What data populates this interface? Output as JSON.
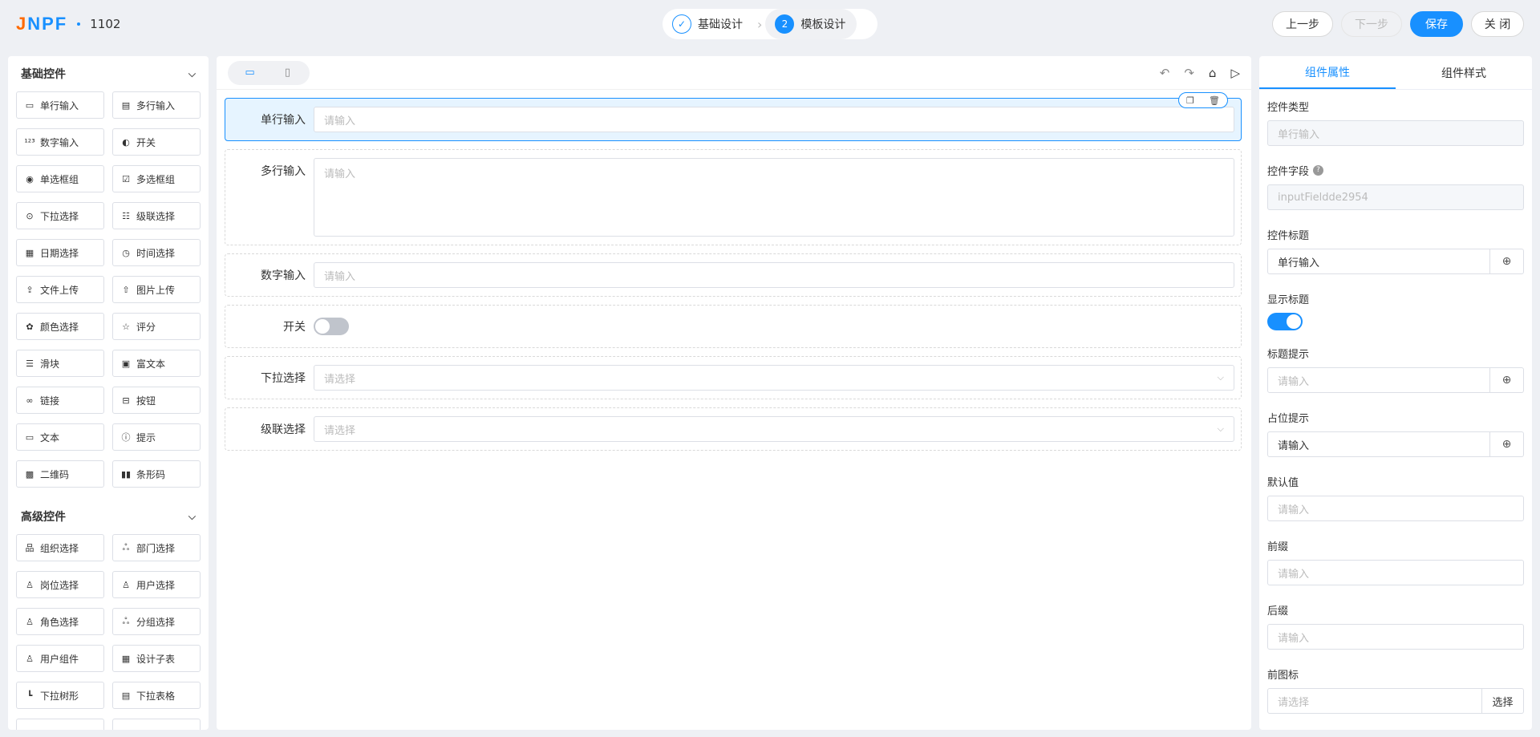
{
  "header": {
    "logo": "JNPF",
    "project_name": "1102",
    "steps": [
      {
        "label": "基础设计",
        "marker": "✓"
      },
      {
        "label": "模板设计",
        "marker": "2"
      }
    ],
    "buttons": {
      "prev": "上一步",
      "next": "下一步",
      "save": "保存",
      "close": "关 闭"
    }
  },
  "left_panel": {
    "basic_title": "基础控件",
    "basic_items": [
      {
        "label": "单行输入",
        "icon": "input-icon"
      },
      {
        "label": "多行输入",
        "icon": "textarea-icon"
      },
      {
        "label": "数字输入",
        "icon": "number-icon"
      },
      {
        "label": "开关",
        "icon": "switch-icon"
      },
      {
        "label": "单选框组",
        "icon": "radio-icon"
      },
      {
        "label": "多选框组",
        "icon": "checkbox-icon"
      },
      {
        "label": "下拉选择",
        "icon": "select-icon"
      },
      {
        "label": "级联选择",
        "icon": "cascader-icon"
      },
      {
        "label": "日期选择",
        "icon": "calendar-icon"
      },
      {
        "label": "时间选择",
        "icon": "clock-icon"
      },
      {
        "label": "文件上传",
        "icon": "upload-icon"
      },
      {
        "label": "图片上传",
        "icon": "image-upload-icon"
      },
      {
        "label": "颜色选择",
        "icon": "palette-icon"
      },
      {
        "label": "评分",
        "icon": "star-icon"
      },
      {
        "label": "滑块",
        "icon": "slider-icon"
      },
      {
        "label": "富文本",
        "icon": "rich-text-icon"
      },
      {
        "label": "链接",
        "icon": "link-icon"
      },
      {
        "label": "按钮",
        "icon": "button-icon"
      },
      {
        "label": "文本",
        "icon": "text-icon"
      },
      {
        "label": "提示",
        "icon": "alert-icon"
      },
      {
        "label": "二维码",
        "icon": "qrcode-icon"
      },
      {
        "label": "条形码",
        "icon": "barcode-icon"
      }
    ],
    "advanced_title": "高级控件",
    "advanced_items": [
      {
        "label": "组织选择",
        "icon": "org-icon"
      },
      {
        "label": "部门选择",
        "icon": "department-icon"
      },
      {
        "label": "岗位选择",
        "icon": "position-icon"
      },
      {
        "label": "用户选择",
        "icon": "user-icon"
      },
      {
        "label": "角色选择",
        "icon": "role-icon"
      },
      {
        "label": "分组选择",
        "icon": "group-icon"
      },
      {
        "label": "用户组件",
        "icon": "user-component-icon"
      },
      {
        "label": "设计子表",
        "icon": "table-icon"
      },
      {
        "label": "下拉树形",
        "icon": "tree-icon"
      },
      {
        "label": "下拉表格",
        "icon": "select-table-icon"
      }
    ]
  },
  "canvas": {
    "fields": [
      {
        "label": "单行输入",
        "placeholder": "请输入"
      },
      {
        "label": "多行输入",
        "placeholder": "请输入"
      },
      {
        "label": "数字输入",
        "placeholder": "请输入"
      },
      {
        "label": "开关"
      },
      {
        "label": "下拉选择",
        "placeholder": "请选择"
      },
      {
        "label": "级联选择",
        "placeholder": "请选择"
      }
    ]
  },
  "right_panel": {
    "tabs": [
      "组件属性",
      "组件样式"
    ],
    "props": {
      "type_label": "控件类型",
      "type_value": "单行输入",
      "field_label": "控件字段",
      "field_value": "inputFieldde2954",
      "title_label": "控件标题",
      "title_value": "单行输入",
      "show_title_label": "显示标题",
      "show_title_on": true,
      "tip_label": "标题提示",
      "tip_placeholder": "请输入",
      "placeholder_label": "占位提示",
      "placeholder_value": "请输入",
      "default_label": "默认值",
      "default_placeholder": "请输入",
      "prefix_label": "前缀",
      "prefix_placeholder": "请输入",
      "suffix_label": "后缀",
      "suffix_placeholder": "请输入",
      "prefix_icon_label": "前图标",
      "prefix_icon_placeholder": "请选择",
      "prefix_icon_button": "选择"
    }
  },
  "colors": {
    "accent": "#1890ff",
    "logo_j": "#ff6a00"
  }
}
